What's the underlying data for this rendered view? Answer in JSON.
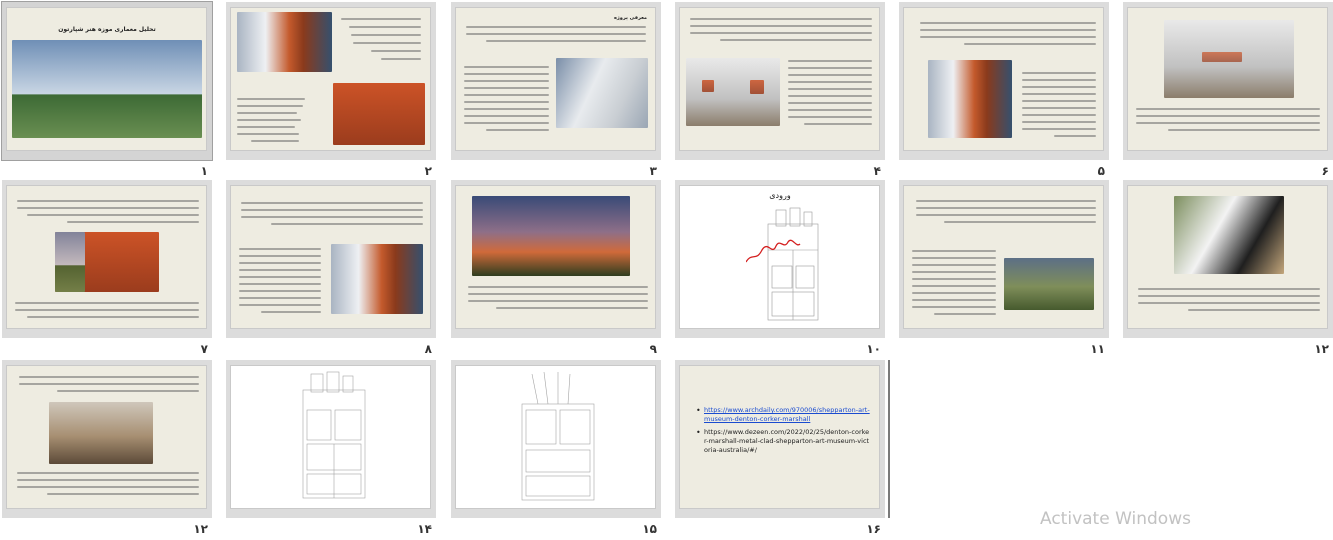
{
  "slides": [
    {
      "number": "۱",
      "title": "تحلیل معماری موزه هنر شپارتون"
    },
    {
      "number": "۲"
    },
    {
      "number": "۳",
      "heading": "معرفی پروژه"
    },
    {
      "number": "۴"
    },
    {
      "number": "۵"
    },
    {
      "number": "۶"
    },
    {
      "number": "۷"
    },
    {
      "number": "۸"
    },
    {
      "number": "۹"
    },
    {
      "number": "۱۰",
      "title": "ورودی"
    },
    {
      "number": "۱۱"
    },
    {
      "number": "۱۲"
    },
    {
      "number": "۱۲"
    },
    {
      "number": "۱۴"
    },
    {
      "number": "۱۵"
    },
    {
      "number": "۱۶"
    }
  ],
  "slide16": {
    "link1": "https://www.archdaily.com/970006/shepparton-art-museum-denton-corker-marshall",
    "link2": "https://www.dezeen.com/2022/02/25/denton-corker-marshall-metal-clad-shepparton-art-museum-victoria-australia/#/"
  },
  "watermark": {
    "line1": "Activate Windows"
  }
}
